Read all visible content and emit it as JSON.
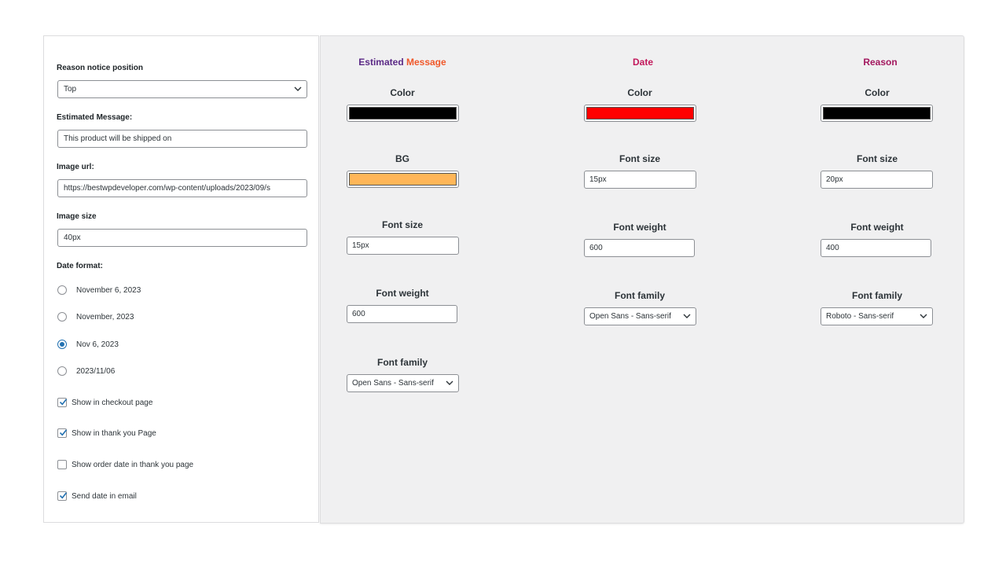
{
  "settings": {
    "position_label": "Reason notice position",
    "position_value": "Top",
    "estimated_label": "Estimated Message:",
    "estimated_value": "This product will be shipped on",
    "image_url_label": "Image url:",
    "image_url_value": "https://bestwpdeveloper.com/wp-content/uploads/2023/09/s",
    "image_size_label": "Image size",
    "image_size_value": "40px",
    "date_format_label": "Date format:",
    "date_formats": [
      {
        "label": "November 6, 2023",
        "selected": false
      },
      {
        "label": "November, 2023",
        "selected": false
      },
      {
        "label": "Nov 6, 2023",
        "selected": true
      },
      {
        "label": "2023/11/06",
        "selected": false
      }
    ],
    "checkboxes": [
      {
        "label": "Show in checkout page",
        "checked": true
      },
      {
        "label": "Show in thank you Page",
        "checked": true
      },
      {
        "label": "Show order date in thank you page",
        "checked": false
      },
      {
        "label": "Send date in email",
        "checked": true
      }
    ]
  },
  "styles": {
    "estimated": {
      "title_part1": "Estimated ",
      "title_part2": "Message",
      "color_label": "Color",
      "color": "#000000",
      "bg_label": "BG",
      "bg": "#ffb658",
      "font_size_label": "Font size",
      "font_size": "15px",
      "font_weight_label": "Font weight",
      "font_weight": "600",
      "font_family_label": "Font family",
      "font_family": "Open Sans - Sans-serif"
    },
    "date": {
      "title": "Date",
      "color_label": "Color",
      "color": "#ff0000",
      "font_size_label": "Font size",
      "font_size": "15px",
      "font_weight_label": "Font weight",
      "font_weight": "600",
      "font_family_label": "Font family",
      "font_family": "Open Sans - Sans-serif"
    },
    "reason": {
      "title": "Reason",
      "color_label": "Color",
      "color": "#000000",
      "font_size_label": "Font size",
      "font_size": "20px",
      "font_weight_label": "Font weight",
      "font_weight": "400",
      "font_family_label": "Font family",
      "font_family": "Roboto - Sans-serif"
    }
  },
  "theme": {
    "title_purple": "#5b2a86",
    "title_orange": "#f0582a",
    "title_magenta": "#c2185b",
    "title_reason": "#a3185f",
    "checkbox_accent": "#2271b1"
  }
}
